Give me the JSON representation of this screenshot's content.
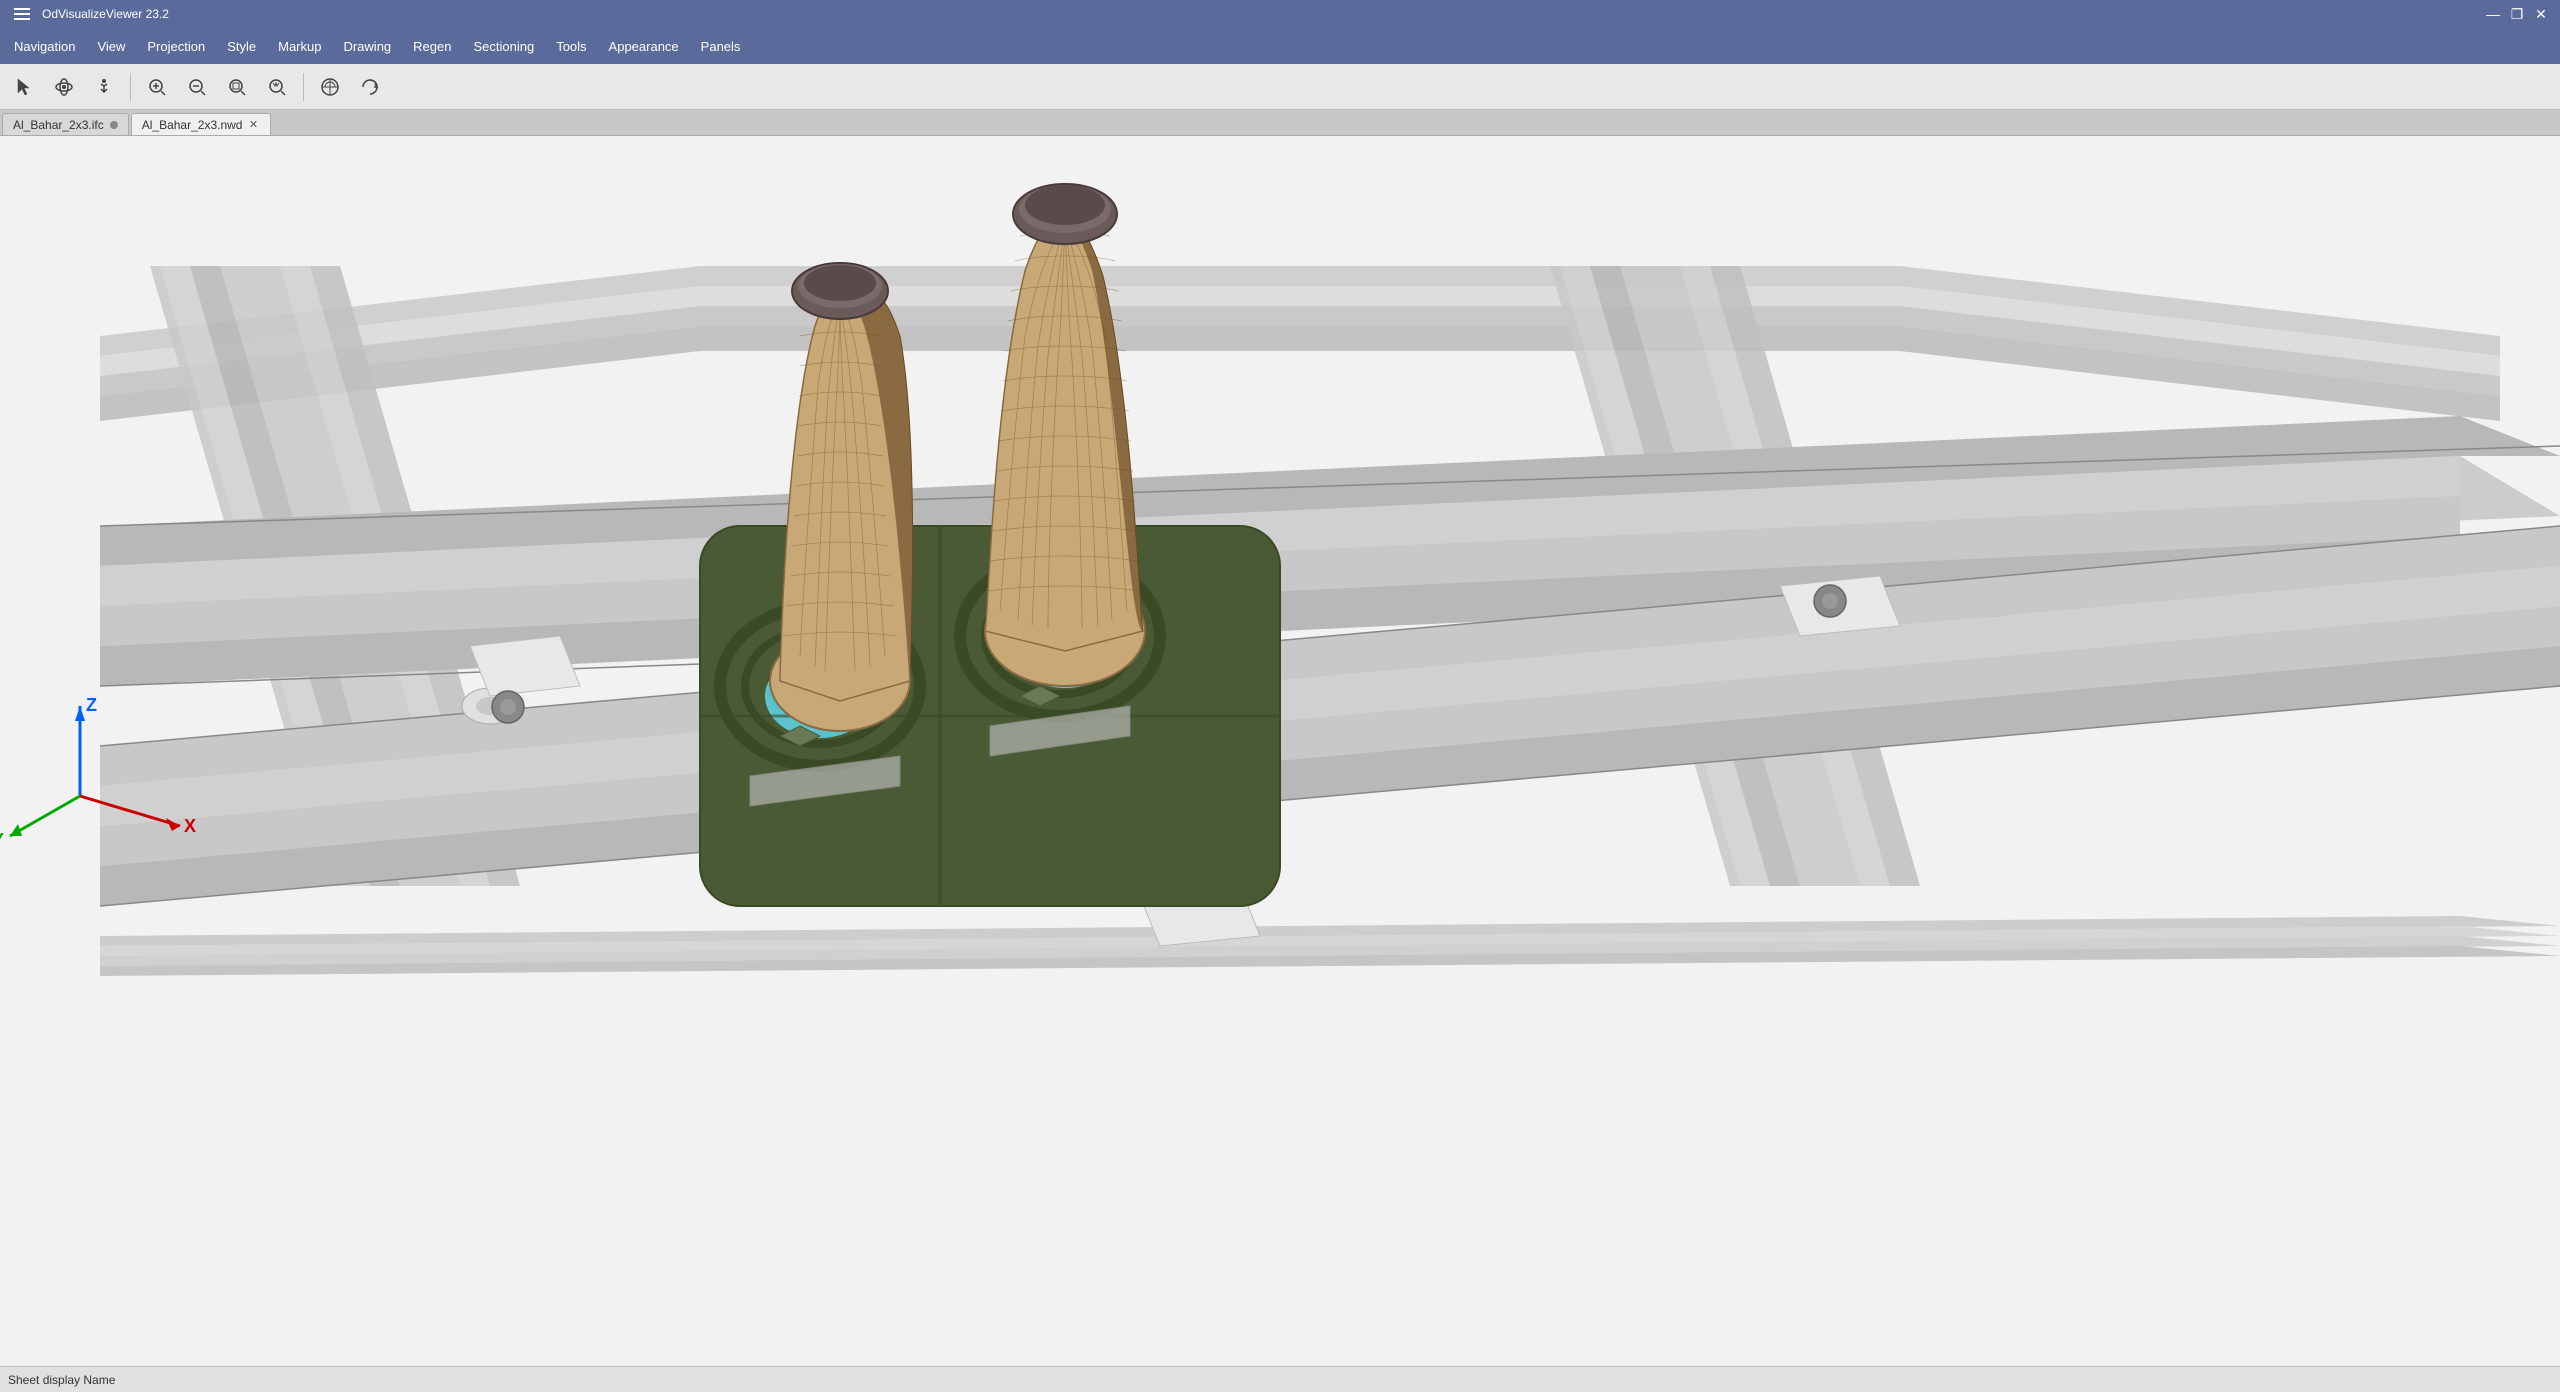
{
  "app": {
    "title": "OdVisualizeViewer 23.2",
    "title_controls": {
      "minimize": "—",
      "restore": "❐",
      "close": "✕"
    }
  },
  "menu": {
    "items": [
      {
        "id": "navigation",
        "label": "Navigation"
      },
      {
        "id": "view",
        "label": "View"
      },
      {
        "id": "projection",
        "label": "Projection"
      },
      {
        "id": "style",
        "label": "Style"
      },
      {
        "id": "markup",
        "label": "Markup"
      },
      {
        "id": "drawing",
        "label": "Drawing"
      },
      {
        "id": "regen",
        "label": "Regen"
      },
      {
        "id": "sectioning",
        "label": "Sectioning"
      },
      {
        "id": "tools",
        "label": "Tools"
      },
      {
        "id": "appearance",
        "label": "Appearance"
      },
      {
        "id": "panels",
        "label": "Panels"
      }
    ]
  },
  "toolbar": {
    "buttons": [
      {
        "id": "select",
        "icon": "✋",
        "tooltip": "Select"
      },
      {
        "id": "orbit",
        "icon": "⟳",
        "tooltip": "Orbit"
      },
      {
        "id": "walk",
        "icon": "⊕",
        "tooltip": "Walk"
      },
      {
        "id": "zoom-in",
        "icon": "⊕",
        "tooltip": "Zoom In"
      },
      {
        "id": "zoom-out",
        "icon": "⊖",
        "tooltip": "Zoom Out"
      },
      {
        "id": "zoom-window",
        "icon": "⊡",
        "tooltip": "Zoom Window"
      },
      {
        "id": "zoom-extents",
        "icon": "⊛",
        "tooltip": "Zoom Extents"
      },
      {
        "id": "view-home",
        "icon": "◎",
        "tooltip": "View Home"
      },
      {
        "id": "view-orbit",
        "icon": "↺",
        "tooltip": "View Orbit"
      }
    ]
  },
  "tabs": [
    {
      "id": "tab1",
      "label": "Al_Bahar_2x3.ifc",
      "active": false,
      "closeable": false
    },
    {
      "id": "tab2",
      "label": "Al_Bahar_2x3.nwd",
      "active": true,
      "closeable": true
    }
  ],
  "statusbar": {
    "text": "Sheet display Name"
  },
  "axis": {
    "x_label": "X",
    "y_label": "Y",
    "z_label": "Z"
  },
  "colors": {
    "titlebar_bg": "#5a6a9a",
    "toolbar_bg": "#e8e8e8",
    "viewport_bg": "#f2f2f2",
    "building_fill": "#b8956a",
    "building_stroke": "#8a6a40",
    "ground_dark": "#3a4a2a",
    "ground_medium": "#4a5a3a",
    "water_fill": "#5dd6e8",
    "road_fill": "#a0a0a0",
    "road_stripe": "#d0d0d0"
  }
}
